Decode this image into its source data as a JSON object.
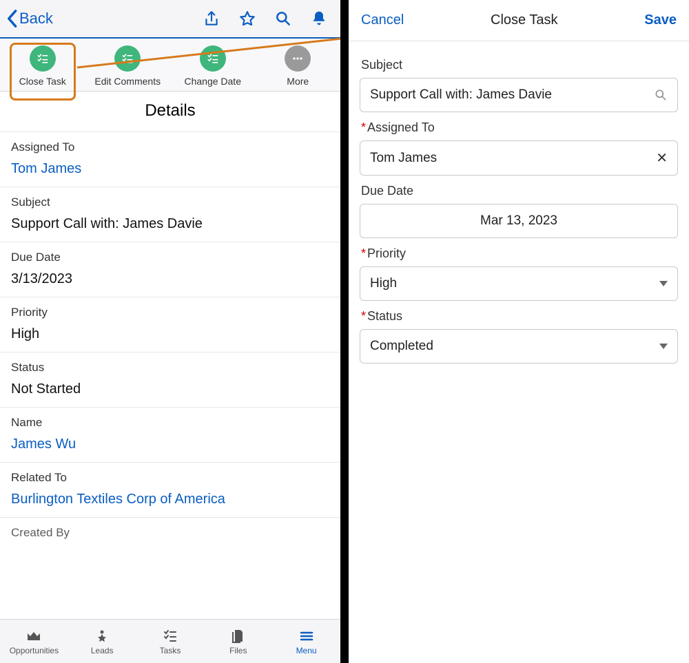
{
  "left": {
    "back_label": "Back",
    "actions": [
      {
        "label": "Close Task"
      },
      {
        "label": "Edit Comments"
      },
      {
        "label": "Change Date"
      },
      {
        "label": "More"
      }
    ],
    "details_heading": "Details",
    "fields": {
      "assigned_to": {
        "label": "Assigned To",
        "value": "Tom James"
      },
      "subject": {
        "label": "Subject",
        "value": "Support Call with: James Davie"
      },
      "due_date": {
        "label": "Due Date",
        "value": "3/13/2023"
      },
      "priority": {
        "label": "Priority",
        "value": "High"
      },
      "status": {
        "label": "Status",
        "value": "Not Started"
      },
      "name": {
        "label": "Name",
        "value": "James Wu"
      },
      "related_to": {
        "label": "Related To",
        "value": "Burlington Textiles Corp of America"
      },
      "created_by": {
        "label": "Created By",
        "value": ""
      }
    },
    "nav": {
      "opportunities": "Opportunities",
      "leads": "Leads",
      "tasks": "Tasks",
      "files": "Files",
      "menu": "Menu"
    }
  },
  "right": {
    "cancel_label": "Cancel",
    "title": "Close Task",
    "save_label": "Save",
    "fields": {
      "subject": {
        "label": "Subject",
        "value": "Support Call with: James Davie"
      },
      "assigned_to": {
        "label": "Assigned To",
        "value": "Tom James"
      },
      "due_date": {
        "label": "Due Date",
        "value": "Mar 13, 2023"
      },
      "priority": {
        "label": "Priority",
        "value": "High"
      },
      "status": {
        "label": "Status",
        "value": "Completed"
      }
    }
  },
  "colors": {
    "accent_blue": "#0a5ec2",
    "action_green": "#3fb67b",
    "highlight_orange": "#d77a1c"
  }
}
